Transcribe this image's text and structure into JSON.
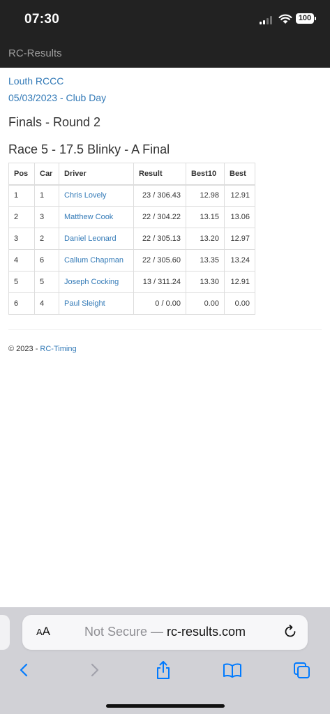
{
  "status_bar": {
    "time": "07:30",
    "battery": "100"
  },
  "navbar": {
    "brand": "RC-Results"
  },
  "breadcrumb": {
    "club": "Louth RCCC",
    "event": "05/03/2023 - Club Day"
  },
  "round_title": "Finals - Round 2",
  "race_title": "Race 5 - 17.5 Blinky - A Final",
  "table": {
    "headers": [
      "Pos",
      "Car",
      "Driver",
      "Result",
      "Best10",
      "Best"
    ],
    "rows": [
      [
        "1",
        "1",
        "Chris Lovely",
        "23 / 306.43",
        "12.98",
        "12.91"
      ],
      [
        "2",
        "3",
        "Matthew Cook",
        "22 / 304.22",
        "13.15",
        "13.06"
      ],
      [
        "3",
        "2",
        "Daniel Leonard",
        "22 / 305.13",
        "13.20",
        "12.97"
      ],
      [
        "4",
        "6",
        "Callum Chapman",
        "22 / 305.60",
        "13.35",
        "13.24"
      ],
      [
        "5",
        "5",
        "Joseph Cocking",
        "13 / 311.24",
        "13.30",
        "12.91"
      ],
      [
        "6",
        "4",
        "Paul Sleight",
        "0 / 0.00",
        "0.00",
        "0.00"
      ]
    ]
  },
  "footer": {
    "copyright": "© 2023 - ",
    "link": "RC-Timing"
  },
  "browser": {
    "aa_big": "A",
    "aa_small": "A",
    "not_secure": "Not Secure — ",
    "domain": "rc-results.com"
  },
  "colors": {
    "link": "#337ab7",
    "navbar": "#222222",
    "toolbar_icon": "#007aff"
  }
}
